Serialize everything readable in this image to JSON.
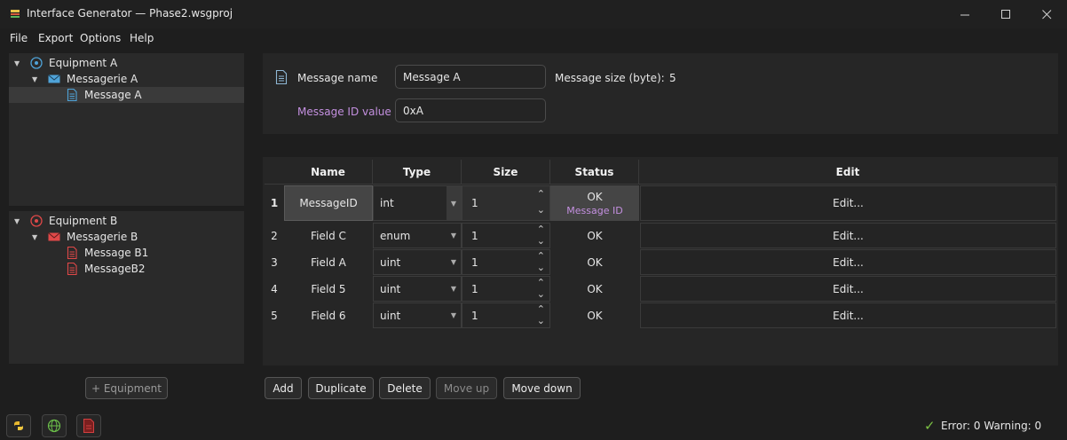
{
  "window": {
    "title": "Interface Generator — Phase2.wsgproj",
    "controls": {
      "minimize": "—",
      "maximize": "☐",
      "close": "✕"
    }
  },
  "menu": [
    "File",
    "Export",
    "Options",
    "Help"
  ],
  "tree": {
    "group_a": {
      "equipment": "Equipment A",
      "messagerie": "Messagerie A",
      "messages": [
        "Message A"
      ],
      "selected": "Message A",
      "color": "#4fa3d8"
    },
    "group_b": {
      "equipment": "Equipment B",
      "messagerie": "Messagerie B",
      "messages": [
        "Message B1",
        "MessageB2"
      ],
      "color": "#e04848"
    }
  },
  "add_equipment_label": "+ Equipment",
  "message_form": {
    "name_label": "Message name",
    "name_value": "Message A",
    "size_label": "Message size (byte):",
    "size_value": "5",
    "id_label": "Message ID value",
    "id_value": "0xA",
    "id_label_color": "#c490e0"
  },
  "table": {
    "headers": {
      "name": "Name",
      "type": "Type",
      "size": "Size",
      "status": "Status",
      "edit": "Edit"
    },
    "rows": [
      {
        "num": "1",
        "name": "MessageID",
        "type": "int",
        "size": "1",
        "status": "OK",
        "status_sub": "Message ID",
        "edit": "Edit..."
      },
      {
        "num": "2",
        "name": "Field C",
        "type": "enum",
        "size": "1",
        "status": "OK",
        "edit": "Edit..."
      },
      {
        "num": "3",
        "name": "Field A",
        "type": "uint",
        "size": "1",
        "status": "OK",
        "edit": "Edit..."
      },
      {
        "num": "4",
        "name": "Field 5",
        "type": "uint",
        "size": "1",
        "status": "OK",
        "edit": "Edit..."
      },
      {
        "num": "5",
        "name": "Field 6",
        "type": "uint",
        "size": "1",
        "status": "OK",
        "edit": "Edit..."
      }
    ],
    "spin_up": "⌃",
    "spin_down": "⌄",
    "combo_arrow": "▼"
  },
  "actions": {
    "add": "Add",
    "duplicate": "Duplicate",
    "delete": "Delete",
    "move_up": "Move up",
    "move_down": "Move down"
  },
  "statusbar": {
    "check": "✓",
    "text": "Error: 0  Warning: 0",
    "icons": [
      "python-icon",
      "globe-icon",
      "pdf-icon"
    ]
  }
}
